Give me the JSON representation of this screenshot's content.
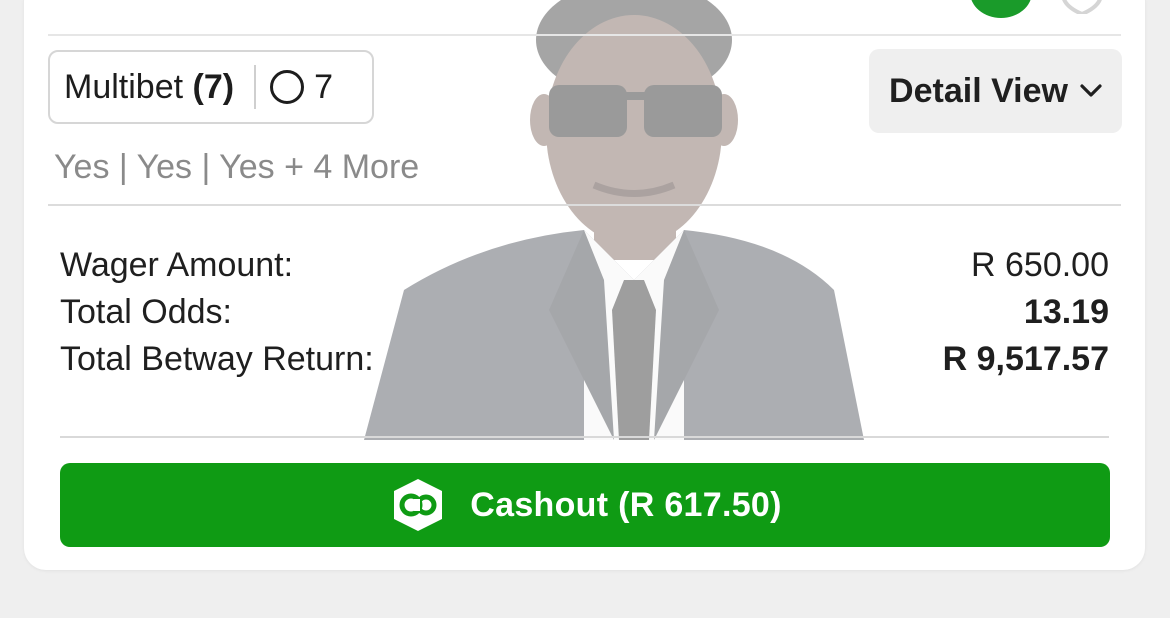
{
  "bet": {
    "type_label": "Multibet",
    "leg_count_label": "(7)",
    "legs_icon": "circle-icon",
    "legs_value": "7",
    "selections_summary": "Yes | Yes | Yes + 4 More"
  },
  "detail_view": {
    "label": "Detail View",
    "icon": "chevron-down-icon"
  },
  "summary": {
    "rows": [
      {
        "label": "Wager Amount:",
        "value": "R 650.00"
      },
      {
        "label": "Total Odds:",
        "value": "13.19"
      },
      {
        "label": "Total Betway Return:",
        "value": "R 9,517.57"
      }
    ]
  },
  "cashout": {
    "label": "Cashout (R 617.50)",
    "icon": "cashout-co-icon"
  },
  "colors": {
    "brand_green": "#0f9b14",
    "top_status_green": "#1a9b2a",
    "page_background": "#efefef"
  }
}
